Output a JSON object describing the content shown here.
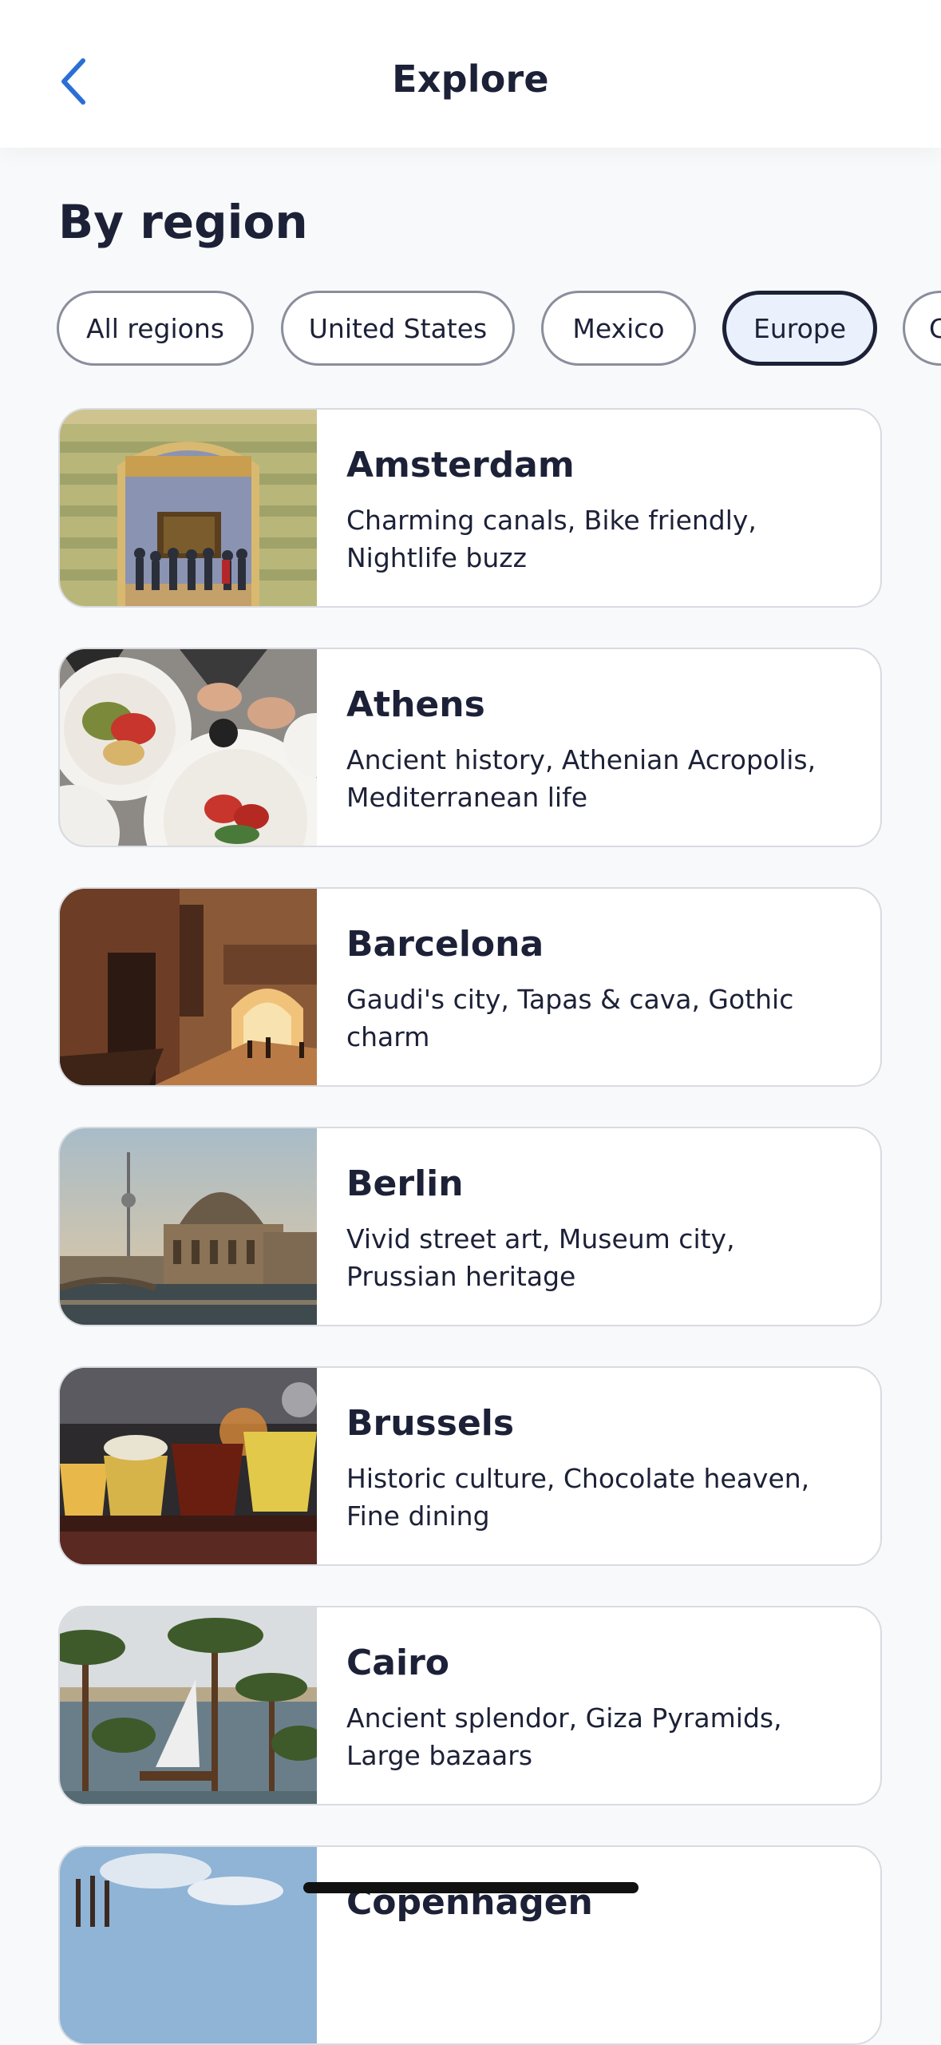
{
  "header": {
    "title": "Explore",
    "back_icon": "chevron-left-icon",
    "accent_color": "#2a6fd6"
  },
  "section": {
    "title": "By region"
  },
  "chips": [
    {
      "label": "All regions",
      "selected": false
    },
    {
      "label": "United States",
      "selected": false
    },
    {
      "label": "Mexico",
      "selected": false
    },
    {
      "label": "Europe",
      "selected": true
    },
    {
      "label": "C",
      "selected": false
    }
  ],
  "destinations": [
    {
      "name": "Amsterdam",
      "description": "Charming canals, Bike friendly, Nightlife buzz"
    },
    {
      "name": "Athens",
      "description": "Ancient history, Athenian Acropolis, Mediterranean life"
    },
    {
      "name": "Barcelona",
      "description": "Gaudi's city, Tapas & cava, Gothic charm"
    },
    {
      "name": "Berlin",
      "description": "Vivid street art, Museum city, Prussian heritage"
    },
    {
      "name": "Brussels",
      "description": "Historic culture, Chocolate heaven, Fine dining"
    },
    {
      "name": "Cairo",
      "description": "Ancient splendor, Giza Pyramids, Large bazaars"
    },
    {
      "name": "Copenhagen",
      "description": ""
    }
  ],
  "colors": {
    "text": "#1c2137",
    "selected_chip_bg": "#eaf1fd",
    "card_border": "#d9dbe1"
  }
}
